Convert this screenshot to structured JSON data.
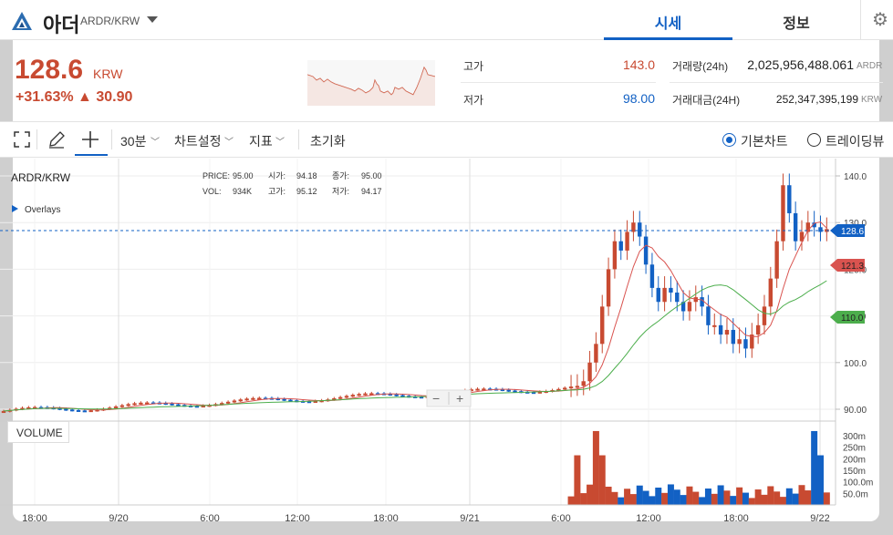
{
  "header": {
    "coin_name": "아더",
    "pair": "ARDR/KRW",
    "tabs": [
      {
        "label": "시세",
        "active": true
      },
      {
        "label": "정보",
        "active": false
      }
    ]
  },
  "ticker": {
    "price": "128.6",
    "unit": "KRW",
    "change": "+31.63% ▲ 30.90",
    "high_label": "고가",
    "high": "143.0",
    "low_label": "저가",
    "low": "98.00",
    "volume_label": "거래량(24h)",
    "volume": "2,025,956,488.061",
    "volume_unit": "ARDR",
    "amount_label": "거래대금(24H)",
    "amount": "252,347,395,199",
    "amount_unit": "KRW"
  },
  "toolbar": {
    "interval": "30분",
    "chart_settings": "차트설정",
    "indicators": "지표",
    "reset": "초기화",
    "basic_chart": "기본차트",
    "trading_view": "트레이딩뷰"
  },
  "chart": {
    "symbol": "ARDR/KRW",
    "overlays": "Overlays",
    "info": {
      "price_label": "PRICE:",
      "price": "95.00",
      "open_label": "시가:",
      "open": "94.18",
      "close_label": "종가:",
      "close": "95.00",
      "vol_label": "VOL:",
      "vol": "934K",
      "high_label": "고가:",
      "high": "95.12",
      "low_label": "저가:",
      "low": "94.17"
    },
    "price_ticks": [
      "140.0",
      "130.0",
      "120.0",
      "110.0",
      "100.0",
      "90.00"
    ],
    "volume_ticks": [
      "300m",
      "250m",
      "200m",
      "150m",
      "100.0m",
      "50.0m"
    ],
    "time_ticks": [
      "18:00",
      "9/20",
      "6:00",
      "12:00",
      "18:00",
      "9/21",
      "6:00",
      "12:00",
      "18:00",
      "9/22"
    ],
    "badges": {
      "current": "128.6",
      "ma_red": "121.3",
      "ma_green": "110.0"
    },
    "volume_label": "VOLUME",
    "zoom_minus": "−",
    "zoom_plus": "+"
  },
  "colors": {
    "up": "#c84a31",
    "down": "#1261c4",
    "ma_red": "#d9534f",
    "ma_green": "#4cae4c",
    "accent": "#1261c4"
  }
}
